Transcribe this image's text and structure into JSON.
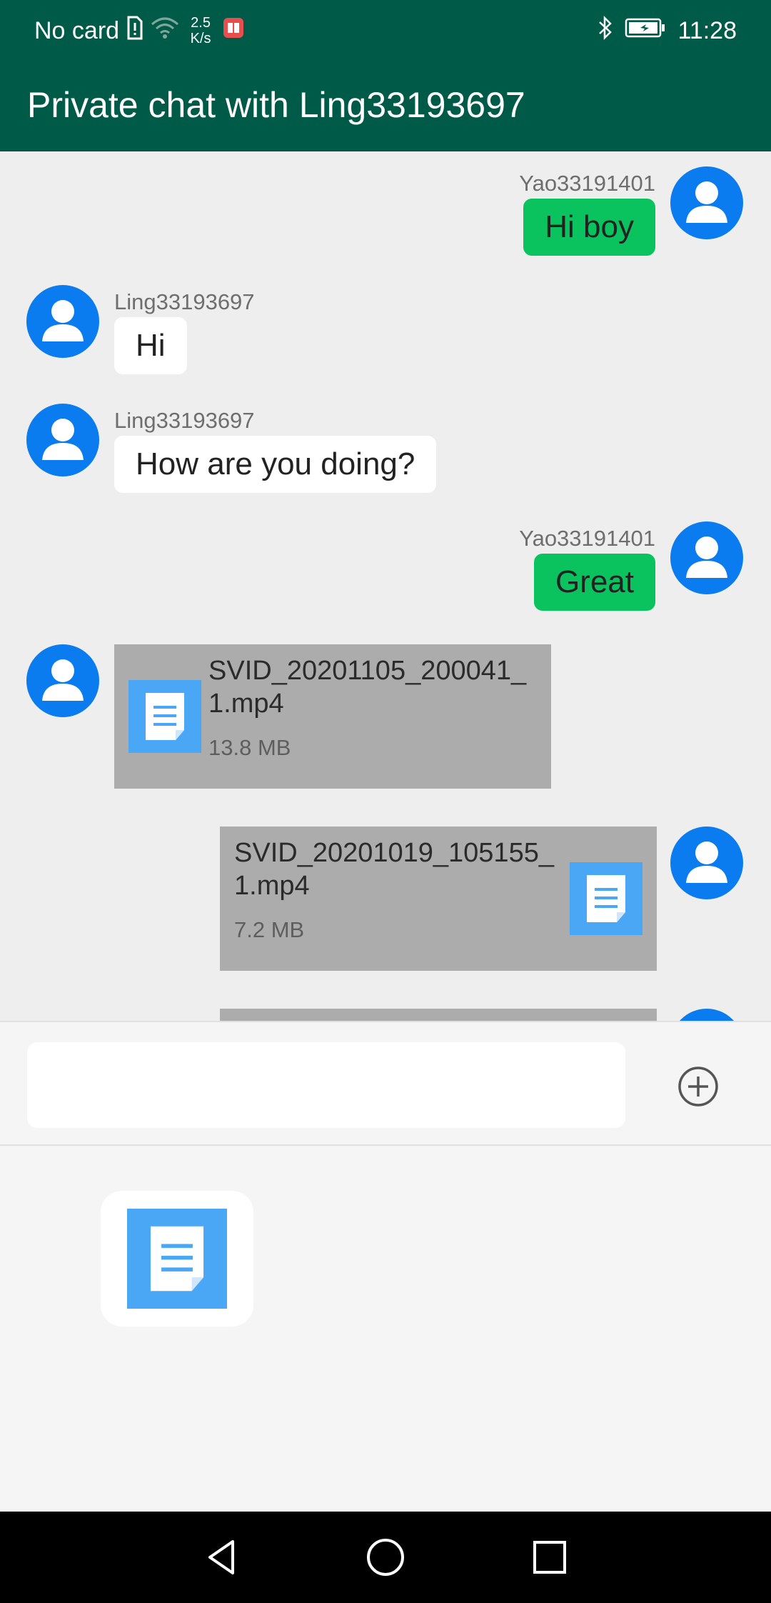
{
  "status_bar": {
    "carrier": "No card",
    "speed_value": "2.5",
    "speed_unit": "K/s",
    "time": "11:28",
    "icons": [
      "sim-alert-icon",
      "wifi-icon",
      "app-notification-icon",
      "bluetooth-icon",
      "battery-charging-icon"
    ]
  },
  "app_bar": {
    "title": "Private chat with Ling33193697"
  },
  "messages": [
    {
      "sender": "Yao33191401",
      "text": "Hi boy",
      "side": "right"
    },
    {
      "sender": "Ling33193697",
      "text": "Hi",
      "side": "left"
    },
    {
      "sender": "Ling33193697",
      "text": "How are you doing?",
      "side": "left"
    },
    {
      "sender": "Yao33191401",
      "text": "Great",
      "side": "right"
    },
    {
      "type": "file",
      "file_name": "SVID_20201105_200041_\n1.mp4",
      "file_size": "13.8 MB",
      "side": "left",
      "icon": "document-icon"
    },
    {
      "type": "file",
      "file_name": "SVID_20201019_105155_\n1.mp4",
      "file_size": "7.2 MB",
      "side": "right",
      "icon": "document-icon"
    }
  ],
  "input": {
    "value": "",
    "placeholder": "",
    "add_icon": "add-circle-icon"
  },
  "attachment_panel": {
    "items": [
      {
        "icon": "document-icon"
      }
    ]
  },
  "nav_bar": {
    "icons": [
      "back-icon",
      "home-icon",
      "recents-icon"
    ]
  },
  "colors": {
    "primary_dark": "#005a48",
    "chat_bg": "#eeeeee",
    "outgoing_bubble": "#0ac25e",
    "incoming_bubble": "#ffffff",
    "avatar": "#0a7cf0",
    "file_card": "#acacac",
    "file_icon": "#4aa7f5"
  }
}
